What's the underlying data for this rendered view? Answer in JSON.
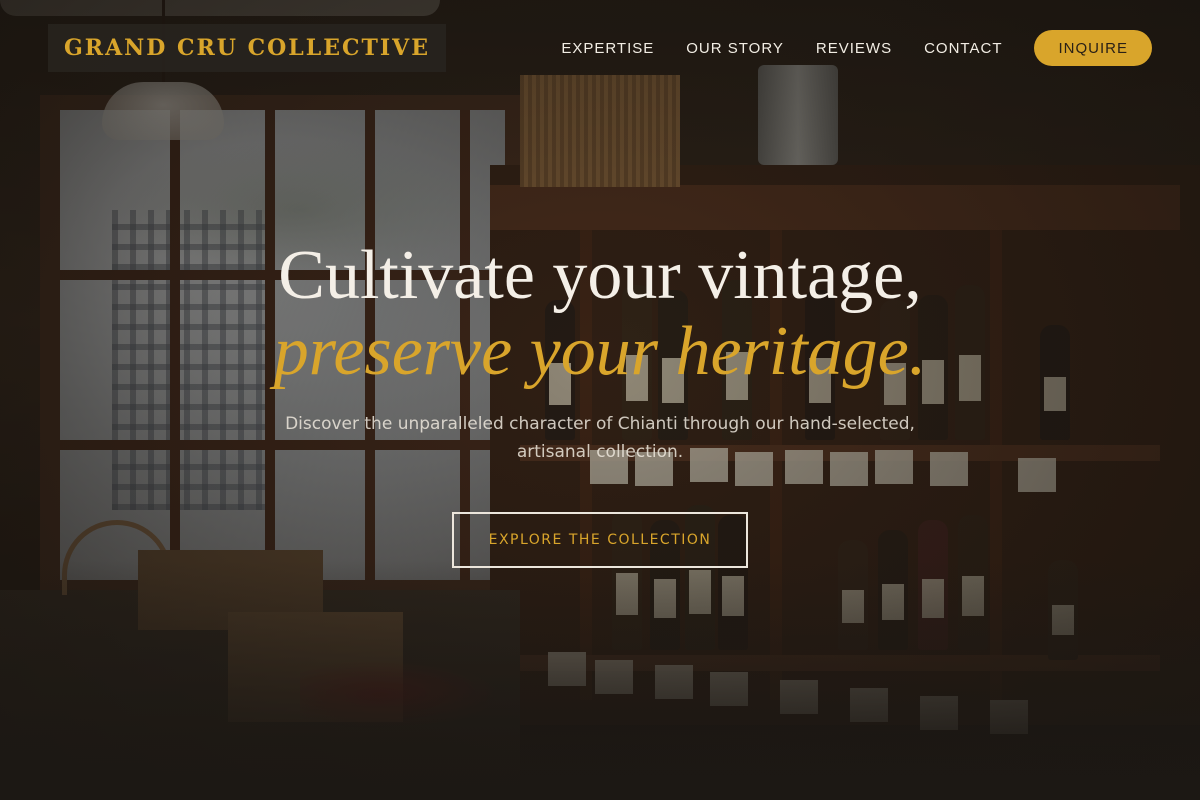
{
  "header": {
    "logo_text": "GRAND CRU COLLECTIVE",
    "nav": {
      "items": [
        {
          "label": "EXPERTISE"
        },
        {
          "label": "OUR STORY"
        },
        {
          "label": "REVIEWS"
        },
        {
          "label": "CONTACT"
        }
      ],
      "cta_label": "INQUIRE"
    }
  },
  "hero": {
    "title_line1": "Cultivate your vintage,",
    "title_line2": "preserve your heritage.",
    "subtitle": "Discover the unparalleled character of Chianti through our hand-selected, artisanal collection.",
    "cta_label": "EXPLORE THE COLLECTION",
    "background_image": "wine-shop-interior-photo"
  },
  "colors": {
    "accent": "#d9a52b",
    "text_light": "#f4efe7",
    "logo_bg": "#28241f"
  }
}
